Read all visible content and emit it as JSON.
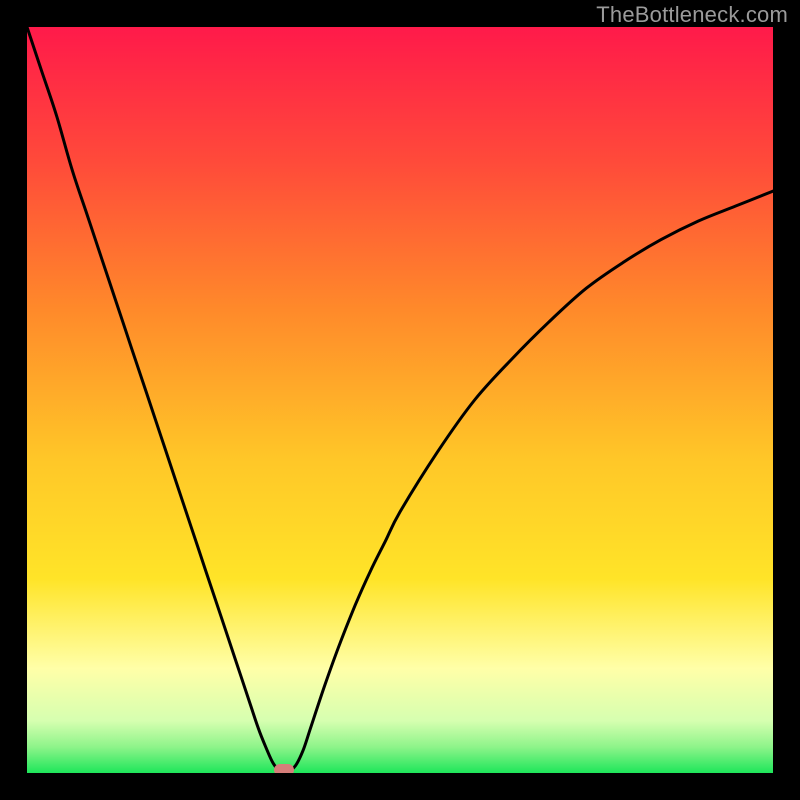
{
  "watermark": "TheBottleneck.com",
  "colors": {
    "black": "#000000",
    "red": "#ff1a4a",
    "orange": "#ff8a2a",
    "yellow": "#ffe428",
    "paleyellow": "#ffffa8",
    "lightgreen": "#b3fca0",
    "green": "#1ee65a",
    "marker": "#d67e7a",
    "curve": "#000000",
    "watermark": "#9a9a9a"
  },
  "chart_data": {
    "type": "line",
    "title": "",
    "xlabel": "",
    "ylabel": "",
    "xlim": [
      0,
      100
    ],
    "ylim": [
      0,
      100
    ],
    "grid": false,
    "legend": false,
    "series": [
      {
        "name": "bottleneck-curve",
        "x": [
          0,
          2,
          4,
          6,
          8,
          10,
          12,
          14,
          16,
          18,
          20,
          22,
          24,
          26,
          28,
          30,
          31,
          32,
          33,
          34,
          35,
          36,
          37,
          38,
          40,
          42,
          44,
          46,
          48,
          50,
          55,
          60,
          65,
          70,
          75,
          80,
          85,
          90,
          95,
          100
        ],
        "y": [
          100,
          94,
          88,
          81,
          75,
          69,
          63,
          57,
          51,
          45,
          39,
          33,
          27,
          21,
          15,
          9,
          6,
          3.5,
          1.3,
          0.2,
          0.2,
          1.0,
          3.0,
          6.0,
          12.0,
          17.5,
          22.5,
          27.0,
          31.0,
          35.0,
          43.0,
          50.0,
          55.5,
          60.5,
          65.0,
          68.5,
          71.5,
          74.0,
          76.0,
          78.0
        ]
      }
    ],
    "marker": {
      "x": 34.5,
      "y": 0.0
    },
    "gradient_stops": [
      {
        "pos": 0.0,
        "color": "#ff1a4a"
      },
      {
        "pos": 0.18,
        "color": "#ff4a3a"
      },
      {
        "pos": 0.38,
        "color": "#ff8a2a"
      },
      {
        "pos": 0.58,
        "color": "#ffc728"
      },
      {
        "pos": 0.74,
        "color": "#ffe428"
      },
      {
        "pos": 0.86,
        "color": "#ffffa8"
      },
      {
        "pos": 0.93,
        "color": "#d6ffb0"
      },
      {
        "pos": 0.965,
        "color": "#8ef48a"
      },
      {
        "pos": 1.0,
        "color": "#1ee65a"
      }
    ]
  }
}
